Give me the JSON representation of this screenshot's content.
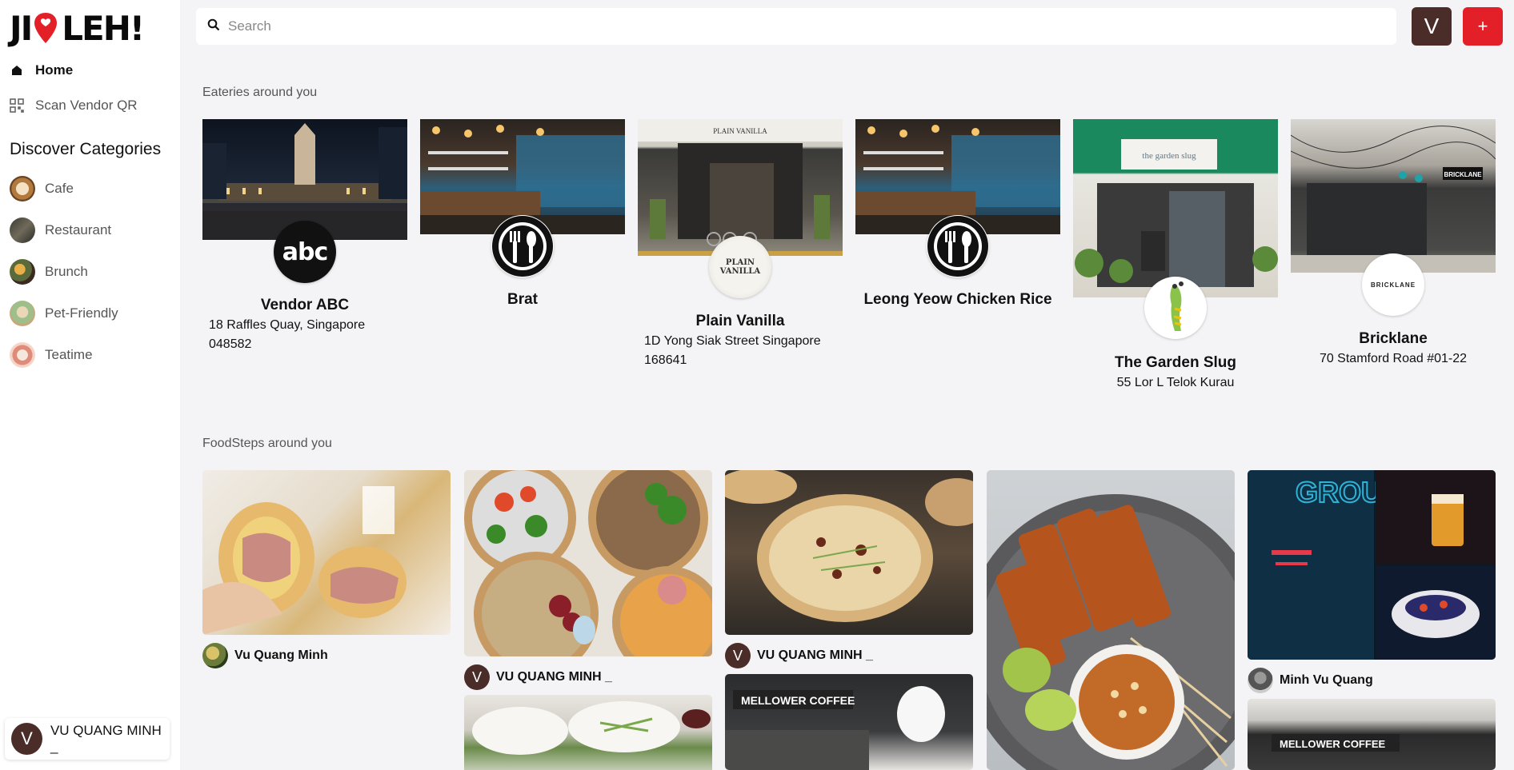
{
  "logo": {
    "left": "JI",
    "right": "LEH!"
  },
  "sidebar": {
    "home_label": "Home",
    "scan_label": "Scan Vendor QR",
    "categories_title": "Discover Categories",
    "categories": [
      {
        "label": "Cafe"
      },
      {
        "label": "Restaurant"
      },
      {
        "label": "Brunch"
      },
      {
        "label": "Pet-Friendly"
      },
      {
        "label": "Teatime"
      }
    ],
    "user": {
      "initial": "V",
      "name": "VU QUANG MINH _"
    }
  },
  "topbar": {
    "search_placeholder": "Search",
    "avatar_initial": "V",
    "add_label": "+"
  },
  "eateries": {
    "title": "Eateries around you",
    "items": [
      {
        "name": "Vendor ABC",
        "address": "18 Raffles Quay, Singapore 048582",
        "badge_text": "abc"
      },
      {
        "name": "Brat",
        "address": ""
      },
      {
        "name": "Plain Vanilla",
        "address": "1D Yong Siak Street Singapore 168641",
        "badge_text": "PLAIN VANILLA",
        "sign_text": "PLAIN VANILLA"
      },
      {
        "name": "Leong Yeow Chicken Rice",
        "address": ""
      },
      {
        "name": "The Garden Slug",
        "address": "55 Lor L Telok Kurau",
        "sign_text": "the garden slug"
      },
      {
        "name": "Bricklane",
        "address": "70 Stamford Road #01-22",
        "badge_text": "BRICKLANE",
        "sign_text": "BRICKLANE"
      }
    ]
  },
  "foodsteps": {
    "title": "FoodSteps around you",
    "items": [
      {
        "user": "Vu Quang Minh"
      },
      {
        "user": "VU QUANG MINH _",
        "initial": "V"
      },
      {
        "user": "VU QUANG MINH _",
        "initial": "V"
      },
      {
        "user": ""
      },
      {
        "user": "Minh Vu Quang",
        "sign_text": "GROU"
      }
    ],
    "second_row": [
      {
        "sign_text": "MELLOWER COFFEE"
      },
      {
        "sign_text": "MELLOWER COFFEE"
      }
    ]
  },
  "colors": {
    "brand_red": "#e32027",
    "avatar_brown": "#4a2c28",
    "background": "#f4f4f6"
  }
}
